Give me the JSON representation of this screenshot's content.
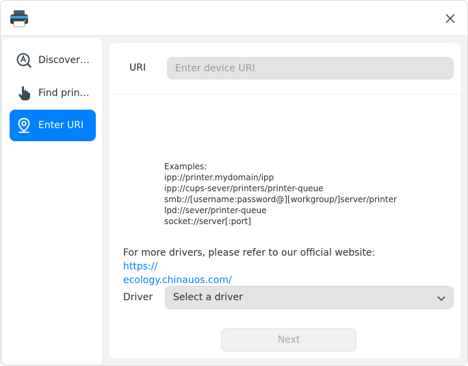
{
  "window": {
    "app_icon": "printer-icon",
    "close_icon": "close-icon"
  },
  "sidebar": {
    "items": [
      {
        "label": "Discover printer",
        "icon": "discover-icon",
        "active": false
      },
      {
        "label": "Find printer",
        "icon": "hand-pointer-icon",
        "active": false
      },
      {
        "label": "Enter URI",
        "icon": "location-pin-icon",
        "active": true
      }
    ]
  },
  "uri": {
    "label": "URI",
    "value": "",
    "placeholder": "Enter device URI"
  },
  "examples": {
    "heading": "Examples:",
    "lines": [
      "ipp://printer.mydomain/ipp",
      "ipp://cups-sever/printers/printer-queue",
      "smb://[username:password@][workgroup/]server/printer",
      "lpd://sever/printer-queue",
      "socket://server[:port]"
    ]
  },
  "drivers_note": {
    "text": "For more drivers, please refer to our official website: ",
    "link_line1": "https://",
    "link_line2": "ecology.chinauos.com/"
  },
  "driver": {
    "label": "Driver",
    "selected": "Select a driver"
  },
  "next_button": {
    "label": "Next"
  },
  "colors": {
    "accent": "#0081ff",
    "input_bg": "#e3e3e3",
    "disabled_text": "#a8a8a8"
  }
}
